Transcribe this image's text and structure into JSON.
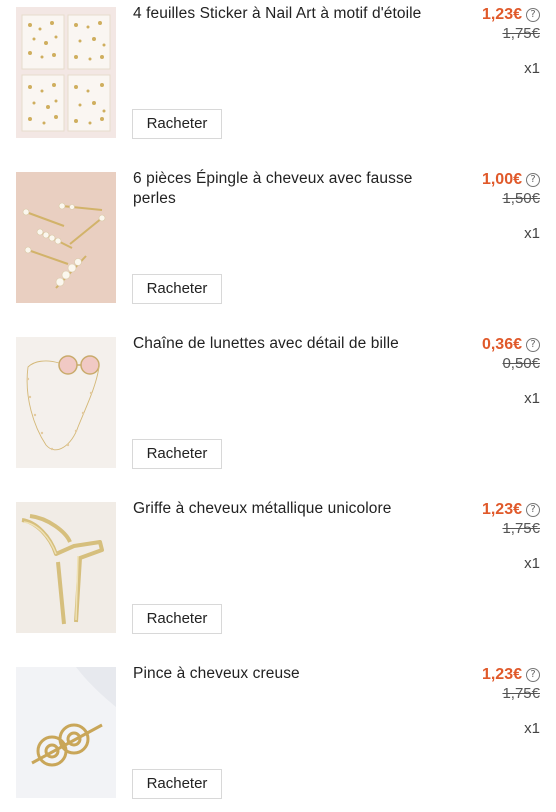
{
  "items": [
    {
      "title": "4 feuilles Sticker à Nail Art à motif d'étoile",
      "price": "1,23€",
      "old_price": "1,75€",
      "quantity": "x1",
      "button_label": "Racheter",
      "image_icon": "nail-sticker-sheets"
    },
    {
      "title": "6 pièces Épingle à cheveux avec fausse perles",
      "price": "1,00€",
      "old_price": "1,50€",
      "quantity": "x1",
      "button_label": "Racheter",
      "image_icon": "pearl-hair-pins"
    },
    {
      "title": "Chaîne de lunettes avec détail de bille",
      "price": "0,36€",
      "old_price": "0,50€",
      "quantity": "x1",
      "button_label": "Racheter",
      "image_icon": "glasses-chain"
    },
    {
      "title": "Griffe à cheveux métallique unicolore",
      "price": "1,23€",
      "old_price": "1,75€",
      "quantity": "x1",
      "button_label": "Racheter",
      "image_icon": "metal-hair-claw"
    },
    {
      "title": "Pince à cheveux creuse",
      "price": "1,23€",
      "old_price": "1,75€",
      "quantity": "x1",
      "button_label": "Racheter",
      "image_icon": "hollow-hair-clip"
    }
  ],
  "colors": {
    "price": "#e0592a",
    "text": "#222222",
    "button_border": "#d8d8d8"
  }
}
